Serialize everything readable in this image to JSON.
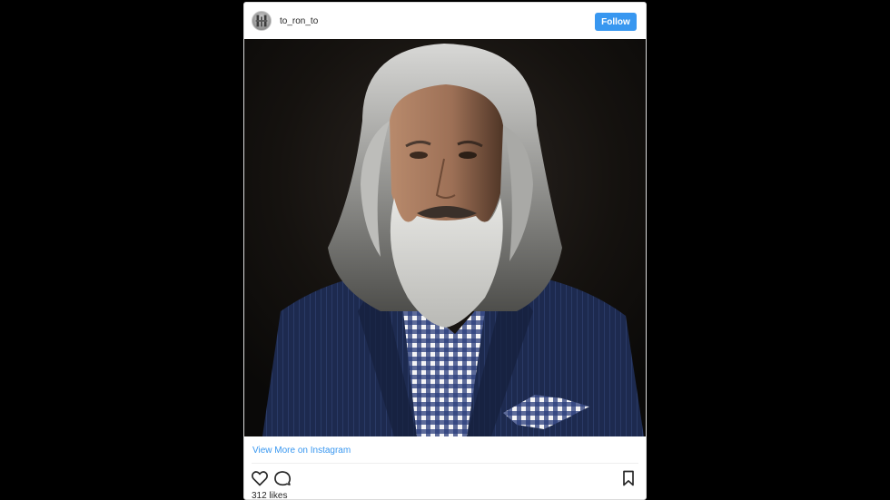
{
  "post": {
    "username": "to_ron_to",
    "follow_label": "Follow",
    "view_more_label": "View More on Instagram",
    "likes_text": "312 likes"
  },
  "icons": {
    "like": "heart-icon",
    "comment": "comment-icon",
    "save": "bookmark-icon"
  },
  "colors": {
    "accent": "#3897f0",
    "background": "#000000",
    "card": "#ffffff"
  }
}
